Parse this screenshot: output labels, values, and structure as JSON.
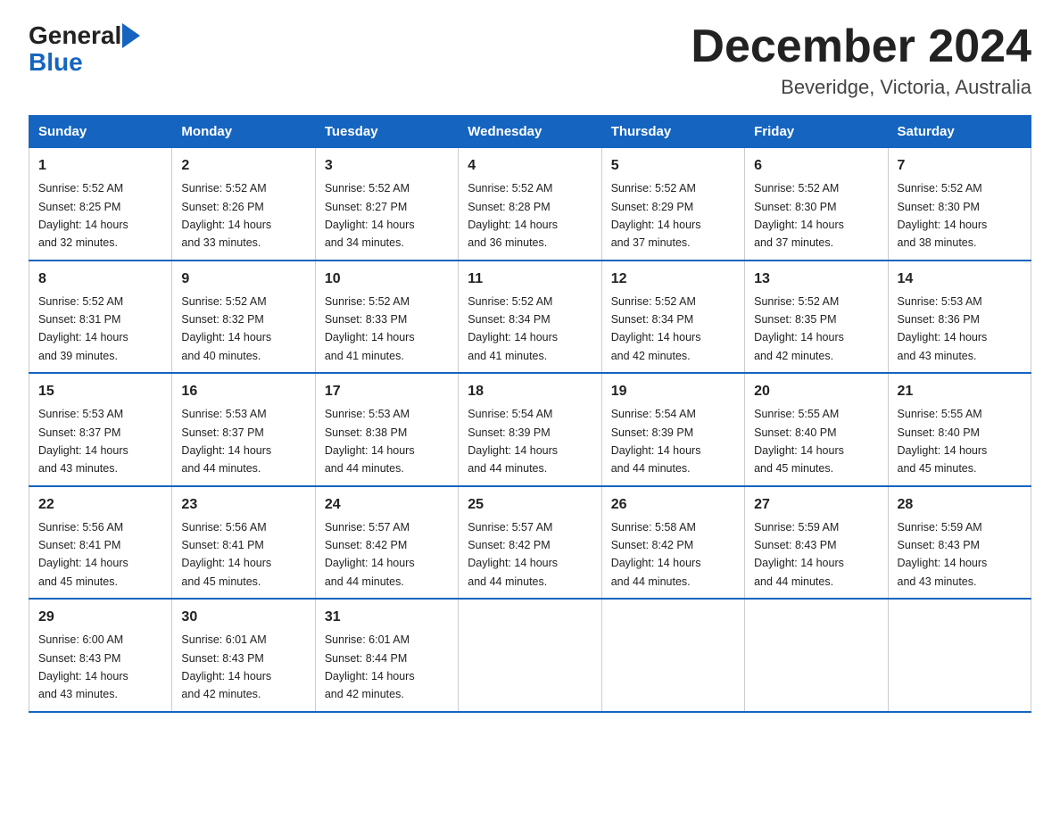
{
  "header": {
    "title": "December 2024",
    "subtitle": "Beveridge, Victoria, Australia",
    "logo_general": "General",
    "logo_blue": "Blue"
  },
  "weekdays": [
    "Sunday",
    "Monday",
    "Tuesday",
    "Wednesday",
    "Thursday",
    "Friday",
    "Saturday"
  ],
  "weeks": [
    [
      {
        "day": "1",
        "sunrise": "5:52 AM",
        "sunset": "8:25 PM",
        "daylight": "14 hours and 32 minutes."
      },
      {
        "day": "2",
        "sunrise": "5:52 AM",
        "sunset": "8:26 PM",
        "daylight": "14 hours and 33 minutes."
      },
      {
        "day": "3",
        "sunrise": "5:52 AM",
        "sunset": "8:27 PM",
        "daylight": "14 hours and 34 minutes."
      },
      {
        "day": "4",
        "sunrise": "5:52 AM",
        "sunset": "8:28 PM",
        "daylight": "14 hours and 36 minutes."
      },
      {
        "day": "5",
        "sunrise": "5:52 AM",
        "sunset": "8:29 PM",
        "daylight": "14 hours and 37 minutes."
      },
      {
        "day": "6",
        "sunrise": "5:52 AM",
        "sunset": "8:30 PM",
        "daylight": "14 hours and 37 minutes."
      },
      {
        "day": "7",
        "sunrise": "5:52 AM",
        "sunset": "8:30 PM",
        "daylight": "14 hours and 38 minutes."
      }
    ],
    [
      {
        "day": "8",
        "sunrise": "5:52 AM",
        "sunset": "8:31 PM",
        "daylight": "14 hours and 39 minutes."
      },
      {
        "day": "9",
        "sunrise": "5:52 AM",
        "sunset": "8:32 PM",
        "daylight": "14 hours and 40 minutes."
      },
      {
        "day": "10",
        "sunrise": "5:52 AM",
        "sunset": "8:33 PM",
        "daylight": "14 hours and 41 minutes."
      },
      {
        "day": "11",
        "sunrise": "5:52 AM",
        "sunset": "8:34 PM",
        "daylight": "14 hours and 41 minutes."
      },
      {
        "day": "12",
        "sunrise": "5:52 AM",
        "sunset": "8:34 PM",
        "daylight": "14 hours and 42 minutes."
      },
      {
        "day": "13",
        "sunrise": "5:52 AM",
        "sunset": "8:35 PM",
        "daylight": "14 hours and 42 minutes."
      },
      {
        "day": "14",
        "sunrise": "5:53 AM",
        "sunset": "8:36 PM",
        "daylight": "14 hours and 43 minutes."
      }
    ],
    [
      {
        "day": "15",
        "sunrise": "5:53 AM",
        "sunset": "8:37 PM",
        "daylight": "14 hours and 43 minutes."
      },
      {
        "day": "16",
        "sunrise": "5:53 AM",
        "sunset": "8:37 PM",
        "daylight": "14 hours and 44 minutes."
      },
      {
        "day": "17",
        "sunrise": "5:53 AM",
        "sunset": "8:38 PM",
        "daylight": "14 hours and 44 minutes."
      },
      {
        "day": "18",
        "sunrise": "5:54 AM",
        "sunset": "8:39 PM",
        "daylight": "14 hours and 44 minutes."
      },
      {
        "day": "19",
        "sunrise": "5:54 AM",
        "sunset": "8:39 PM",
        "daylight": "14 hours and 44 minutes."
      },
      {
        "day": "20",
        "sunrise": "5:55 AM",
        "sunset": "8:40 PM",
        "daylight": "14 hours and 45 minutes."
      },
      {
        "day": "21",
        "sunrise": "5:55 AM",
        "sunset": "8:40 PM",
        "daylight": "14 hours and 45 minutes."
      }
    ],
    [
      {
        "day": "22",
        "sunrise": "5:56 AM",
        "sunset": "8:41 PM",
        "daylight": "14 hours and 45 minutes."
      },
      {
        "day": "23",
        "sunrise": "5:56 AM",
        "sunset": "8:41 PM",
        "daylight": "14 hours and 45 minutes."
      },
      {
        "day": "24",
        "sunrise": "5:57 AM",
        "sunset": "8:42 PM",
        "daylight": "14 hours and 44 minutes."
      },
      {
        "day": "25",
        "sunrise": "5:57 AM",
        "sunset": "8:42 PM",
        "daylight": "14 hours and 44 minutes."
      },
      {
        "day": "26",
        "sunrise": "5:58 AM",
        "sunset": "8:42 PM",
        "daylight": "14 hours and 44 minutes."
      },
      {
        "day": "27",
        "sunrise": "5:59 AM",
        "sunset": "8:43 PM",
        "daylight": "14 hours and 44 minutes."
      },
      {
        "day": "28",
        "sunrise": "5:59 AM",
        "sunset": "8:43 PM",
        "daylight": "14 hours and 43 minutes."
      }
    ],
    [
      {
        "day": "29",
        "sunrise": "6:00 AM",
        "sunset": "8:43 PM",
        "daylight": "14 hours and 43 minutes."
      },
      {
        "day": "30",
        "sunrise": "6:01 AM",
        "sunset": "8:43 PM",
        "daylight": "14 hours and 42 minutes."
      },
      {
        "day": "31",
        "sunrise": "6:01 AM",
        "sunset": "8:44 PM",
        "daylight": "14 hours and 42 minutes."
      },
      null,
      null,
      null,
      null
    ]
  ],
  "labels": {
    "sunrise": "Sunrise:",
    "sunset": "Sunset:",
    "daylight": "Daylight:"
  }
}
